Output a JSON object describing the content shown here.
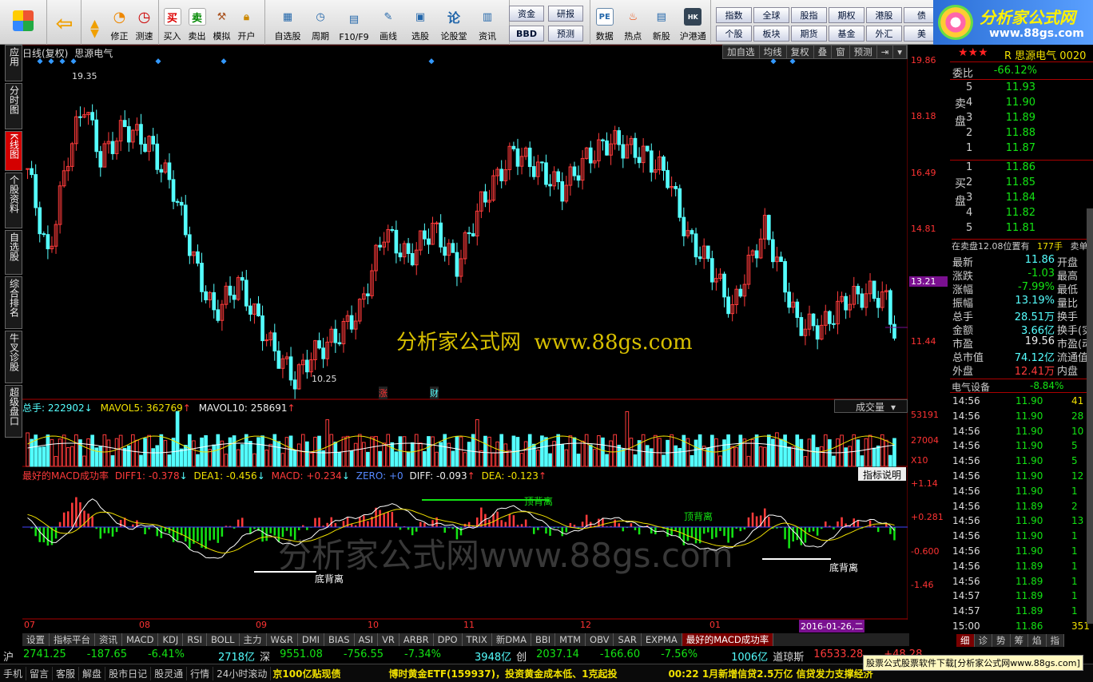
{
  "toolbar": {
    "group1": [
      "修正",
      "测速"
    ],
    "group2": [
      "买入",
      "卖出",
      "模拟",
      "开户"
    ],
    "group3": [
      "自选股",
      "周期",
      "F10/F9",
      "画线",
      "选股",
      "论股堂",
      "资讯"
    ],
    "btns_row1": [
      "资金",
      "研报"
    ],
    "btns_row2": [
      "BBD",
      "预测"
    ],
    "group4": [
      "数据",
      "热点",
      "新股",
      "沪港通"
    ],
    "nav_row1": [
      "指数",
      "全球",
      "股指",
      "期权",
      "港股",
      "债"
    ],
    "nav_row2": [
      "个股",
      "板块",
      "期货",
      "基金",
      "外汇",
      "美"
    ],
    "logo_text": "分析家公式网",
    "logo_url": "www.88gs.com"
  },
  "left_tabs": [
    "应用",
    "分时图",
    "K线图",
    "个股资料",
    "自选股",
    "综合排名",
    "牛叉诊股",
    "超级盘口"
  ],
  "chart_header": {
    "period": "日线(复权)",
    "stock_name": "思源电气",
    "tools": [
      "加自选",
      "均线",
      "复权",
      "叠",
      "窗",
      "预测"
    ],
    "watermark_center": "分析家公式网  www.88gs.com",
    "watermark_macd": "分析家公式网www.88gs.com"
  },
  "price_axis": [
    "19.86",
    "18.18",
    "16.49",
    "14.81",
    "13.21",
    "11.44"
  ],
  "current_price_label": "13.21",
  "high_label": "19.35",
  "low_label": "10.25",
  "markers": [
    "涨",
    "财"
  ],
  "volume_header": {
    "total": "总手: 222902",
    "mavol5": "MAVOL5: 362769",
    "mavol10": "MAVOL10: 258691",
    "dropdown": "成交量"
  },
  "volume_axis": [
    "53191",
    "27004",
    "X10"
  ],
  "macd_header": {
    "name": "最好的MACD成功率",
    "diff1": "DIFF1: -0.378",
    "dea1": "DEA1: -0.456",
    "macd": "MACD: +0.234",
    "zero": "ZERO: +0",
    "diff": "DIFF: -0.093",
    "dea": "DEA: -0.123",
    "help": "指标说明"
  },
  "macd_axis": [
    "+1.14",
    "+0.281",
    "-0.600",
    "-1.46"
  ],
  "macd_annotations": [
    "顶背离",
    "顶背离",
    "底背离",
    "底背离"
  ],
  "date_axis": [
    "07",
    "08",
    "09",
    "10",
    "11",
    "12",
    "01"
  ],
  "date_cursor": "2016-01-26,二",
  "bottom_tabs": [
    "设置",
    "指标平台",
    "资讯",
    "MACD",
    "KDJ",
    "RSI",
    "BOLL",
    "主力",
    "W&R",
    "DMI",
    "BIAS",
    "ASI",
    "VR",
    "ARBR",
    "DPO",
    "TRIX",
    "新DMA",
    "BBI",
    "MTM",
    "OBV",
    "SAR",
    "EXPMA",
    "最好的MACD成功率"
  ],
  "quote_panel": {
    "title": "R 思源电气 0020",
    "weibi_label": "委比",
    "weibi": "-66.12%",
    "sell": [
      [
        "5",
        "11.93"
      ],
      [
        "4",
        "11.90"
      ],
      [
        "3",
        "11.89"
      ],
      [
        "2",
        "11.88"
      ],
      [
        "1",
        "11.87"
      ]
    ],
    "buy": [
      [
        "1",
        "11.86"
      ],
      [
        "2",
        "11.85"
      ],
      [
        "3",
        "11.84"
      ],
      [
        "4",
        "11.82"
      ],
      [
        "5",
        "11.81"
      ]
    ],
    "sell_label": "卖盘",
    "buy_label": "买盘",
    "zaimai": "在卖盘12.08位置有",
    "zaimai_vol": "177手",
    "zaimai_tail": "卖单",
    "stats": [
      [
        "最新",
        "11.86",
        "开盘"
      ],
      [
        "涨跌",
        "-1.03",
        "最高"
      ],
      [
        "涨幅",
        "-7.99%",
        "最低"
      ],
      [
        "振幅",
        "13.19%",
        "量比"
      ],
      [
        "总手",
        "28.51万",
        "换手"
      ],
      [
        "金额",
        "3.66亿",
        "换手(实"
      ],
      [
        "市盈",
        "19.56",
        "市盈(动"
      ],
      [
        "总市值",
        "74.12亿",
        "流通值"
      ],
      [
        "外盘",
        "12.41万",
        "内盘"
      ]
    ],
    "sector": "电气设备",
    "sector_pct": "-8.84%",
    "ticks": [
      [
        "14:56",
        "11.90",
        "41"
      ],
      [
        "14:56",
        "11.90",
        "28"
      ],
      [
        "14:56",
        "11.90",
        "10"
      ],
      [
        "14:56",
        "11.90",
        "5"
      ],
      [
        "14:56",
        "11.90",
        "5"
      ],
      [
        "14:56",
        "11.90",
        "12"
      ],
      [
        "14:56",
        "11.90",
        "1"
      ],
      [
        "14:56",
        "11.89",
        "2"
      ],
      [
        "14:56",
        "11.90",
        "13"
      ],
      [
        "14:56",
        "11.90",
        "1"
      ],
      [
        "14:56",
        "11.90",
        "1"
      ],
      [
        "14:56",
        "11.89",
        "1"
      ],
      [
        "14:56",
        "11.89",
        "1"
      ],
      [
        "14:57",
        "11.89",
        "1"
      ],
      [
        "14:57",
        "11.89",
        "1"
      ],
      [
        "15:00",
        "11.86",
        "351"
      ]
    ],
    "tabs": [
      "细",
      "诊",
      "势",
      "筹",
      "焰",
      "指"
    ]
  },
  "index_bar": [
    {
      "name": "沪",
      "val": "2741.25",
      "chg": "-187.65",
      "pct": "-6.41%",
      "amt": "2718亿"
    },
    {
      "name": "深",
      "val": "9551.08",
      "chg": "-756.55",
      "pct": "-7.34%",
      "amt": "3948亿"
    },
    {
      "name": "创",
      "val": "2037.14",
      "chg": "-166.60",
      "pct": "-7.56%",
      "amt": "1006亿"
    },
    {
      "name": "道琼斯",
      "val": "16533.28",
      "chg": "+48.28",
      "pct": "",
      "amt": ""
    }
  ],
  "status_bar": [
    "手机",
    "留言",
    "客服",
    "解盘",
    "股市日记",
    "股灵通",
    "行情",
    "24小时滚动"
  ],
  "news": [
    "京100亿贴现债",
    "博时黄金ETF(159937)，投资黄金成本低、1克起投",
    "00:22 1月新增信贷2.5万亿 信贷发力支撑经济"
  ],
  "promo": "股票公式股票软件下载[分析家公式网www.88gs.com]",
  "colors": {
    "up": "#ff3b3b",
    "down": "#54ffff",
    "diff": "#ffffff",
    "dea": "#f0e000",
    "zero": "#4444ff"
  }
}
